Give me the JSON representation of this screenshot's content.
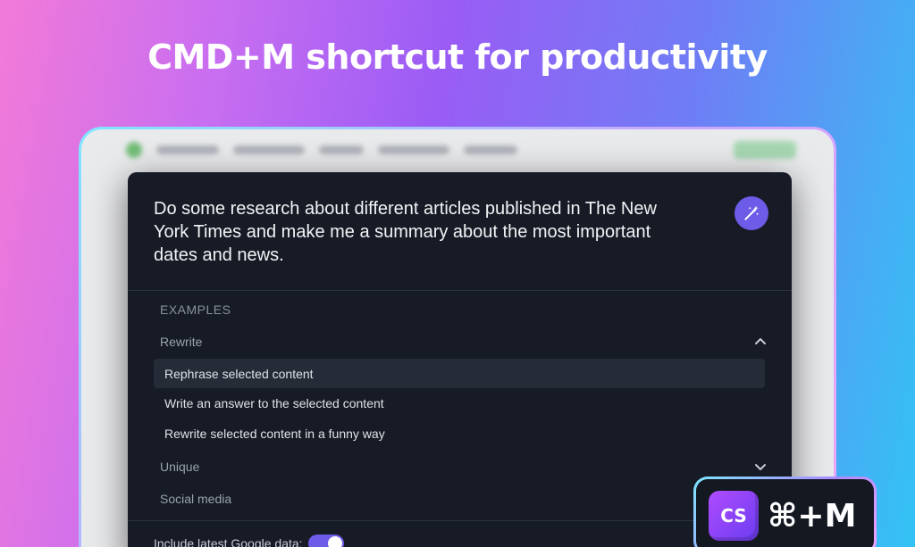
{
  "headline": "CMD+M shortcut for productivity",
  "modal": {
    "prompt": "Do some research about different articles published in The New York Times and make me a summary about the most important dates and news.",
    "examples_label": "EXAMPLES",
    "groups": [
      {
        "label": "Rewrite",
        "expanded": true,
        "items": [
          "Rephrase selected content",
          "Write an answer to the selected content",
          "Rewrite selected content in a funny way"
        ],
        "selected_index": 0
      },
      {
        "label": "Unique",
        "expanded": false
      },
      {
        "label": "Social media",
        "expanded": false
      }
    ],
    "google_label": "Include latest Google data:",
    "google_toggle_on": true
  },
  "badge": {
    "logo_text": "CS",
    "shortcut": "⌘+M"
  },
  "colors": {
    "accent": "#6c5ce7",
    "modal_bg": "#161b26",
    "selected_row": "#252c38"
  },
  "icons": {
    "wand": "magic-wand-icon",
    "chevron_up": "chevron-up-icon",
    "chevron_down": "chevron-down-icon"
  }
}
